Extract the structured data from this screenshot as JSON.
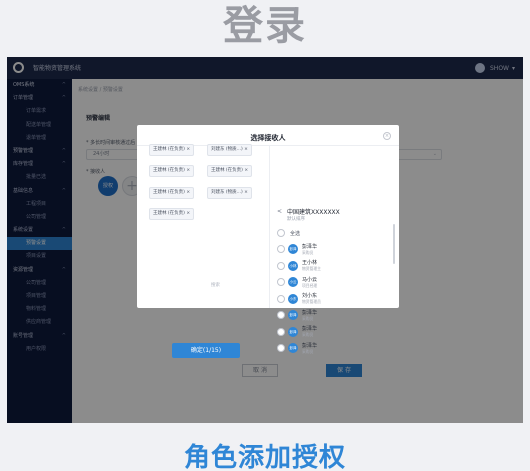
{
  "hero": {
    "title": "登录"
  },
  "caption": "角色添加授权",
  "colors": {
    "accent": "#2f86d6",
    "sidebar": "#0e1a3d",
    "topbar": "#1e2a4d"
  },
  "app": {
    "title": "智能物资管理系统"
  },
  "user": {
    "name": "SHOW",
    "caret": "▾"
  },
  "sidebar": {
    "items": [
      {
        "label": "OMS系统",
        "arrow": "^",
        "kind": "group"
      },
      {
        "label": "订单管理",
        "arrow": "^",
        "kind": "section"
      },
      {
        "label": "订单需求",
        "kind": "sub"
      },
      {
        "label": "配送单管理",
        "kind": "sub"
      },
      {
        "label": "退单管理",
        "kind": "sub"
      },
      {
        "label": "预警管理",
        "arrow": "^",
        "kind": "group"
      },
      {
        "label": "库存管理",
        "arrow": "^",
        "kind": "section"
      },
      {
        "label": "批量已选",
        "kind": "sub"
      },
      {
        "label": "基础信息",
        "arrow": "^",
        "kind": "section"
      },
      {
        "label": "工程项目",
        "kind": "sub"
      },
      {
        "label": "公司管理",
        "kind": "sub"
      },
      {
        "label": "系统设置",
        "arrow": "^",
        "kind": "section"
      },
      {
        "label": "预警设置",
        "kind": "sub",
        "active": true
      },
      {
        "label": "项目设置",
        "kind": "sub"
      },
      {
        "label": "资源管理",
        "arrow": "^",
        "kind": "group"
      },
      {
        "label": "公司管理",
        "kind": "sub"
      },
      {
        "label": "项目管理",
        "kind": "sub"
      },
      {
        "label": "物料管理",
        "kind": "sub"
      },
      {
        "label": "供应商管理",
        "kind": "sub"
      },
      {
        "label": "账号管理",
        "arrow": "^",
        "kind": "section"
      },
      {
        "label": "用户权限",
        "kind": "sub"
      }
    ]
  },
  "content": {
    "breadcrumb": "系统设置 / 预警设置",
    "panel_title": "预警编辑",
    "field_label": "* 多长时间审核通过后",
    "select_value": "24小时",
    "receiver_label": "* 接收人",
    "receiver_avatar": "授权",
    "add_symbol": "+",
    "cancel_label": "取 消",
    "save_label": "保 存"
  },
  "modal": {
    "title": "选择接收人",
    "close": "×",
    "chips": [
      "王建林 (在负责) ×",
      "刘建东 (物质...) ×",
      "王建林 (在负责) ×",
      "王建林 (在负责) ×",
      "王建林 (在负责) ×",
      "刘建东 (物质...) ×",
      "王建林 (在负责) ×"
    ],
    "search_hint": "搜索",
    "confirm_label": "确定(1/15)",
    "org": {
      "back": "<",
      "name": "中国建筑XXXXXXX",
      "sub": "默认排序",
      "all_label": "全选"
    },
    "people": [
      {
        "name": "彭泽华",
        "role": "采购员",
        "initials": "彭泽"
      },
      {
        "name": "王小林",
        "role": "物资管理主",
        "initials": "小林"
      },
      {
        "name": "马小云",
        "role": "项目经理",
        "initials": "小云"
      },
      {
        "name": "刘小东",
        "role": "物资管理员",
        "initials": "小东"
      },
      {
        "name": "彭泽华",
        "role": "采购员",
        "initials": "彭泽"
      },
      {
        "name": "彭泽华",
        "role": "采购员",
        "initials": "彭泽"
      },
      {
        "name": "彭泽华",
        "role": "采购员",
        "initials": "彭泽"
      }
    ]
  }
}
